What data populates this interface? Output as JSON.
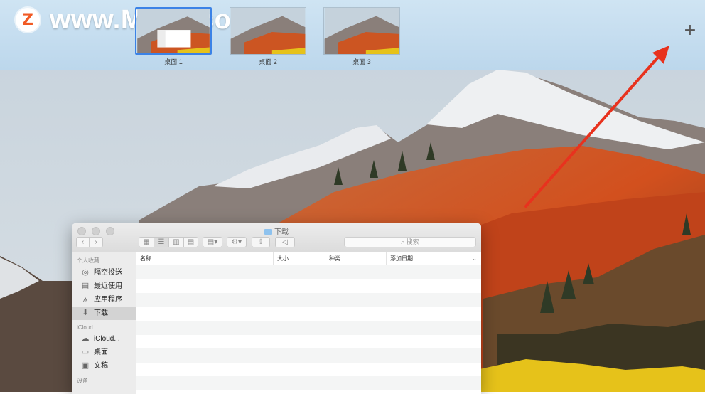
{
  "watermark": {
    "logo_letter": "Z",
    "text": "www.MacZ.com"
  },
  "spaces": {
    "desktops": [
      {
        "label": "桌面 1",
        "active": true
      },
      {
        "label": "桌面 2",
        "active": false
      },
      {
        "label": "桌面 3",
        "active": false
      }
    ],
    "add_label": "+"
  },
  "finder": {
    "title": "下载",
    "search_placeholder": "搜索",
    "sidebar": {
      "favorites_heading": "个人收藏",
      "favorites": [
        {
          "label": "隔空投送",
          "icon": "airdrop-icon"
        },
        {
          "label": "最近使用",
          "icon": "recents-icon"
        },
        {
          "label": "应用程序",
          "icon": "applications-icon"
        },
        {
          "label": "下载",
          "icon": "downloads-icon",
          "selected": true
        }
      ],
      "icloud_heading": "iCloud",
      "icloud": [
        {
          "label": "iCloud...",
          "icon": "cloud-icon"
        },
        {
          "label": "桌面",
          "icon": "desktop-icon"
        },
        {
          "label": "文稿",
          "icon": "documents-icon"
        }
      ],
      "devices_heading": "设备"
    },
    "columns": [
      "名称",
      "大小",
      "种类",
      "添加日期"
    ],
    "sort_indicator": "⌄"
  },
  "colors": {
    "accent": "#3b82e6",
    "arrow": "#e8321e",
    "watermark_logo": "#f15a24"
  }
}
